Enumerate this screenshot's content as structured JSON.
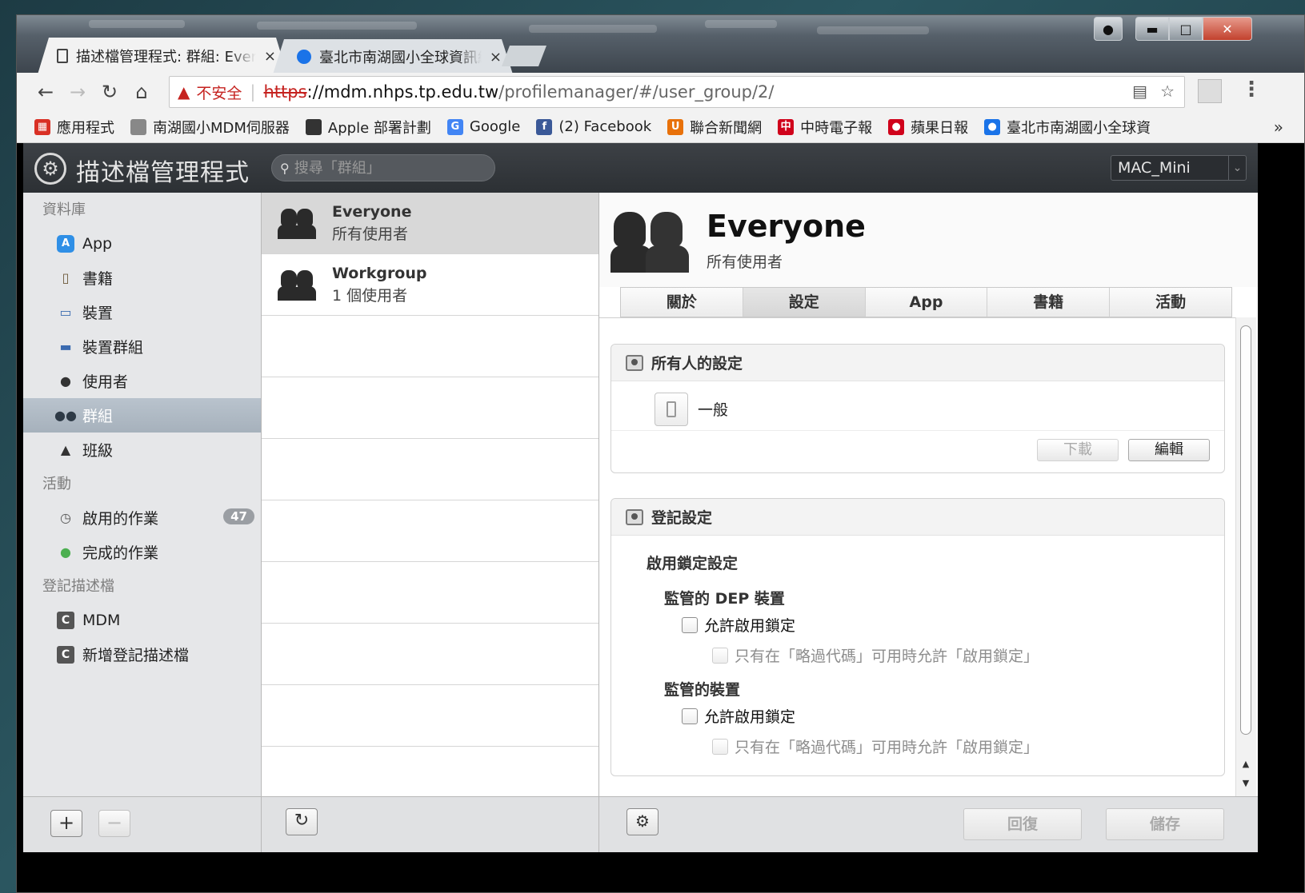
{
  "browser": {
    "active_tab_title": "描述檔管理程式: 群組: Everyone",
    "inactive_tab_title": "臺北市南湖國小全球資訊網",
    "tab_close": "×",
    "url_security_label": "不安全",
    "url_scheme": "https",
    "url_host": "://mdm.nhps.tp.edu.tw",
    "url_path": "/profilemanager/#/user_group/2/",
    "bookmarks": [
      {
        "label": "應用程式",
        "icon": "apps-grid-icon",
        "color": "#d93025"
      },
      {
        "label": "南湖國小MDM伺服器",
        "icon": "page-icon",
        "color": "#888888"
      },
      {
        "label": "Apple 部署計劃",
        "icon": "apple-icon",
        "color": "#333333"
      },
      {
        "label": "Google",
        "icon": "google-icon",
        "color": "#4285f4"
      },
      {
        "label": "(2) Facebook",
        "icon": "facebook-icon",
        "color": "#3b5998"
      },
      {
        "label": "聯合新聞網",
        "icon": "udn-icon",
        "color": "#e8710a"
      },
      {
        "label": "中時電子報",
        "icon": "chinatimes-icon",
        "color": "#d0021b"
      },
      {
        "label": "蘋果日報",
        "icon": "apple-daily-icon",
        "color": "#d0021b"
      },
      {
        "label": "臺北市南湖國小全球資",
        "icon": "globe-icon",
        "color": "#1a73e8"
      }
    ],
    "bookmarks_more": "»"
  },
  "app": {
    "title": "描述檔管理程式",
    "search_placeholder": "搜尋「群組」",
    "server": "MAC_Mini"
  },
  "sidebar": {
    "sections": [
      {
        "title": "資料庫",
        "items": [
          {
            "label": "App",
            "icon": "app-store-icon"
          },
          {
            "label": "書籍",
            "icon": "book-icon"
          },
          {
            "label": "裝置",
            "icon": "device-icon"
          },
          {
            "label": "裝置群組",
            "icon": "device-group-icon"
          },
          {
            "label": "使用者",
            "icon": "user-icon"
          },
          {
            "label": "群組",
            "icon": "group-icon",
            "selected": true
          },
          {
            "label": "班級",
            "icon": "graduation-cap-icon"
          }
        ]
      },
      {
        "title": "活動",
        "items": [
          {
            "label": "啟用的作業",
            "icon": "clock-icon",
            "badge": "47"
          },
          {
            "label": "完成的作業",
            "icon": "check-circle-icon"
          }
        ]
      },
      {
        "title": "登記描述檔",
        "items": [
          {
            "label": "MDM",
            "icon": "enrollment-profile-icon"
          },
          {
            "label": "新增登記描述檔",
            "icon": "enrollment-profile-icon"
          }
        ]
      }
    ],
    "add_label": "+",
    "remove_label": "−"
  },
  "groups": [
    {
      "name": "Everyone",
      "subtitle": "所有使用者",
      "selected": true
    },
    {
      "name": "Workgroup",
      "subtitle": "1 個使用者",
      "selected": false
    }
  ],
  "refresh_label": "↻",
  "detail": {
    "title": "Everyone",
    "subtitle": "所有使用者",
    "tabs": [
      "關於",
      "設定",
      "App",
      "書籍",
      "活動"
    ],
    "selected_tab": 1,
    "settings_panel": {
      "title": "所有人的設定",
      "payload": "一般",
      "download_label": "下載",
      "edit_label": "編輯"
    },
    "enrollment_panel": {
      "title": "登記設定",
      "activation_lock_heading": "啟用鎖定設定",
      "dep_heading": "監管的 DEP 裝置",
      "dep_allow": "允許啟用鎖定",
      "dep_bypass": "只有在「略過代碼」可用時允許「啟用鎖定」",
      "supervised_heading": "監管的裝置",
      "supervised_allow": "允許啟用鎖定",
      "supervised_bypass": "只有在「略過代碼」可用時允許「啟用鎖定」"
    },
    "revert_label": "回復",
    "save_label": "儲存"
  }
}
